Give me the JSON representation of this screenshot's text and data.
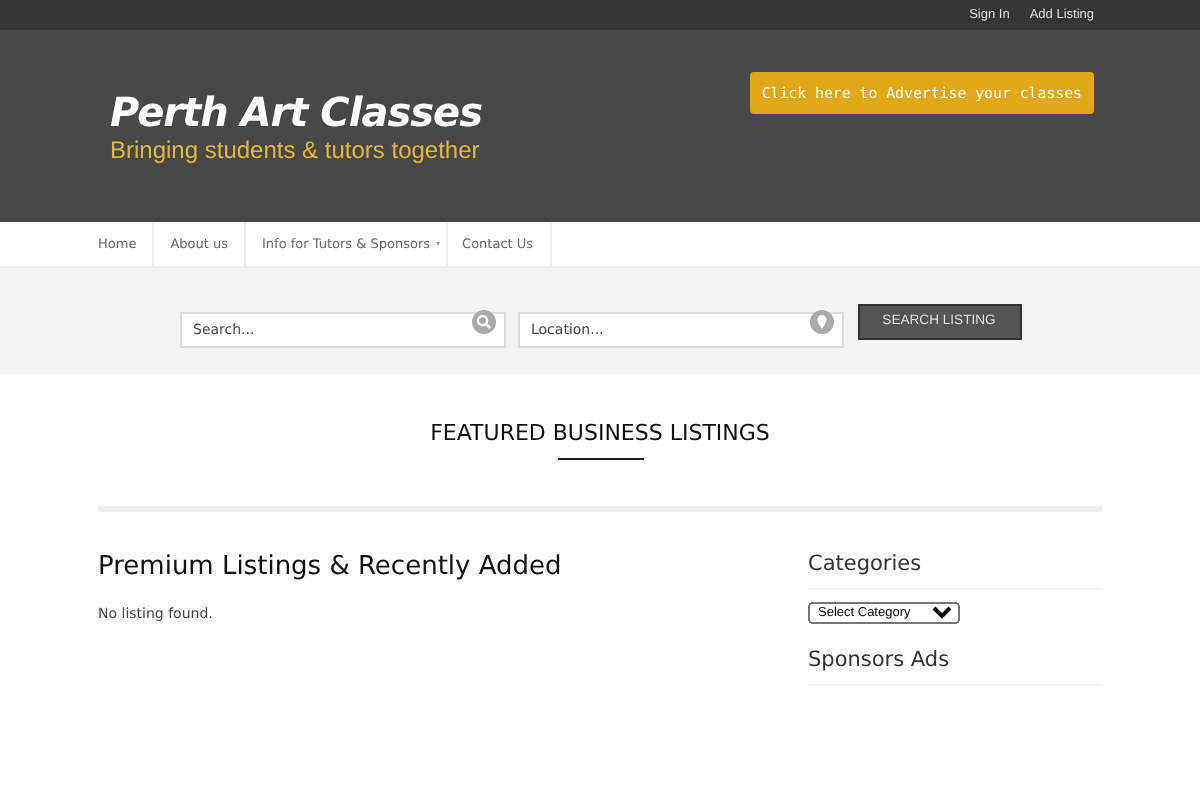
{
  "top_links": [
    "Sign In",
    "Add Listing"
  ],
  "logo": {
    "title": "Perth Art Classes",
    "tagline": "Bringing students & tutors together"
  },
  "advertise_button": "Click here to Advertise your classes",
  "nav": [
    {
      "label": "Home",
      "has_submenu": false
    },
    {
      "label": "About us",
      "has_submenu": false
    },
    {
      "label": "Info for Tutors & Sponsors",
      "has_submenu": true
    },
    {
      "label": "Contact Us",
      "has_submenu": false
    }
  ],
  "search": {
    "keyword_placeholder": "Search...",
    "location_placeholder": "Location...",
    "button": "SEARCH LISTING"
  },
  "featured_title": "FEATURED BUSINESS LISTINGS",
  "main": {
    "title": "Premium Listings & Recently Added",
    "empty_message": "No listing found."
  },
  "sidebar": {
    "categories_title": "Categories",
    "category_select": "Select Category",
    "sponsors_title": "Sponsors Ads"
  }
}
